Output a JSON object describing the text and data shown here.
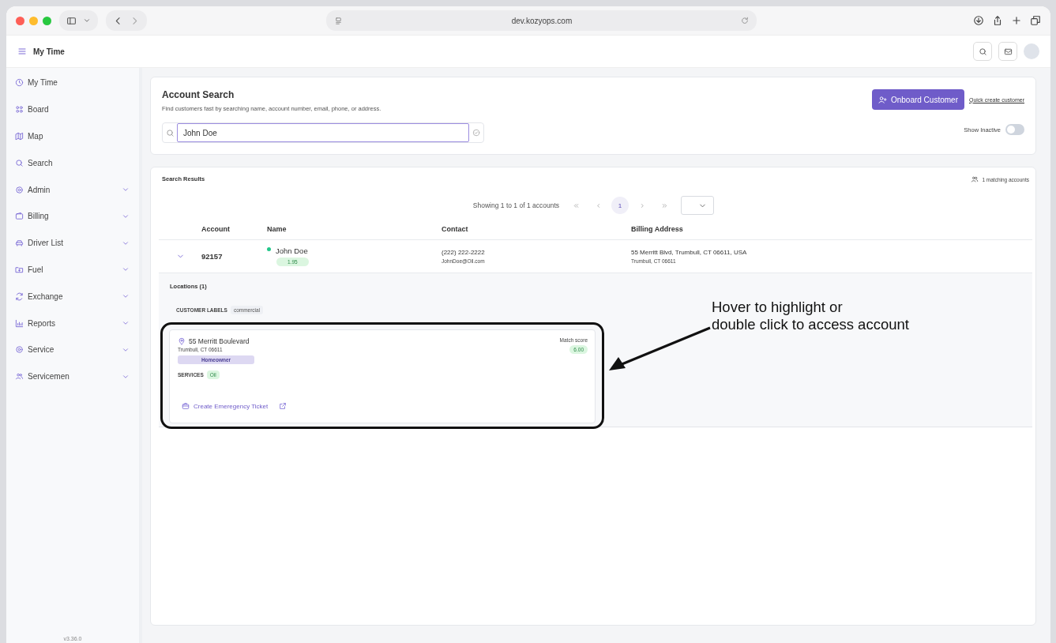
{
  "browser": {
    "address": "dev.kozyops.com"
  },
  "header": {
    "title": "My Time"
  },
  "sidebar": {
    "items": [
      {
        "label": "My Time",
        "has_submenu": false
      },
      {
        "label": "Board",
        "has_submenu": false
      },
      {
        "label": "Map",
        "has_submenu": false
      },
      {
        "label": "Search",
        "has_submenu": false
      },
      {
        "label": "Admin",
        "has_submenu": true
      },
      {
        "label": "Billing",
        "has_submenu": true
      },
      {
        "label": "Driver List",
        "has_submenu": true
      },
      {
        "label": "Fuel",
        "has_submenu": true
      },
      {
        "label": "Exchange",
        "has_submenu": true
      },
      {
        "label": "Reports",
        "has_submenu": true
      },
      {
        "label": "Service",
        "has_submenu": true
      },
      {
        "label": "Servicemen",
        "has_submenu": true
      }
    ],
    "version": "v3.36.0"
  },
  "account_search": {
    "title": "Account Search",
    "subtitle": "Find customers fast by searching name, account number, email, phone, or address.",
    "search": {
      "value": "John Doe"
    },
    "onboard_button": "Onboard Customer",
    "quick_create_link": "Quick create customer",
    "show_inactive": {
      "label": "Show Inactive",
      "on": false
    }
  },
  "results": {
    "title": "Search Results",
    "matching": "1 matching accounts",
    "pagination": {
      "summary": "Showing 1 to 1 of 1 accounts",
      "pages": [
        {
          "label": "1",
          "selected": true
        }
      ]
    },
    "columns": [
      "Account",
      "Name",
      "Contact",
      "Billing Address"
    ],
    "rows": [
      {
        "expanded": true,
        "account": "92157",
        "name": "John Doe",
        "score": "1.95",
        "phone": "(222) 222-2222",
        "email": "JohnDoe@Oil.com",
        "address_line1": "55 Merritt Blvd, Trumbull, CT 06611, USA",
        "address_line2": "Trumbull, CT 06611",
        "details": {
          "locations_title": "Locations (1)",
          "labels_title": "CUSTOMER LABELS",
          "labels": [
            "commercial"
          ],
          "locations": [
            {
              "street": "55 Merritt Boulevard",
              "city": "Trumbull, CT 06611",
              "type": "Homeowner",
              "services_title": "SERVICES",
              "services": [
                "Oil"
              ],
              "match_label": "Match score",
              "match_score": "6.00",
              "ticket_link": "Create Emeregency Ticket"
            }
          ]
        }
      }
    ]
  },
  "annotation": {
    "lines": [
      "Hover to highlight or",
      "double click to access account"
    ]
  }
}
